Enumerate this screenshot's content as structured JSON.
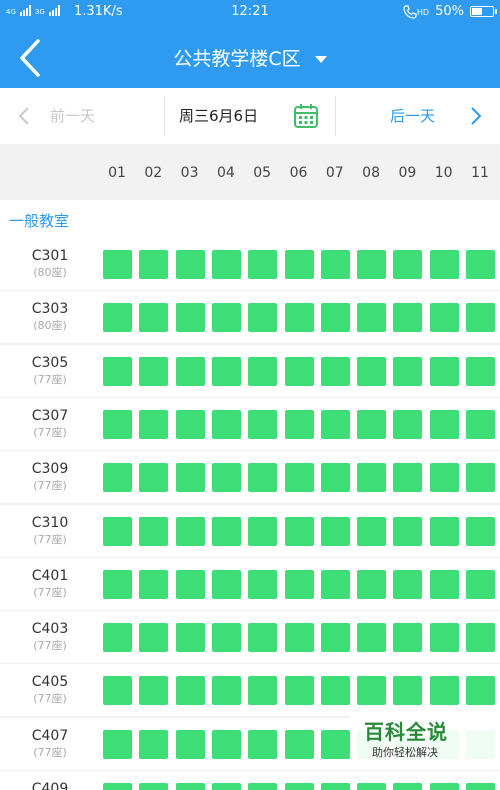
{
  "status_bar": {
    "network_left": "4G",
    "network_mid": "3G",
    "speed": "1.31K/s",
    "time": "12:21",
    "hd_label": "HD",
    "battery": "50%",
    "battery_level": 0.5
  },
  "header": {
    "title": "公共教学楼C区"
  },
  "date_bar": {
    "prev_label": "前一天",
    "current_date": "周三6月6日",
    "next_label": "后一天"
  },
  "columns": [
    "01",
    "02",
    "03",
    "04",
    "05",
    "06",
    "07",
    "08",
    "09",
    "10",
    "11"
  ],
  "section": {
    "label": "一般教室"
  },
  "rooms": [
    {
      "name": "C301",
      "capacity": "(80座)"
    },
    {
      "name": "C303",
      "capacity": "(80座)"
    },
    {
      "name": "C305",
      "capacity": "(77座)"
    },
    {
      "name": "C307",
      "capacity": "(77座)"
    },
    {
      "name": "C309",
      "capacity": "(77座)"
    },
    {
      "name": "C310",
      "capacity": "(77座)"
    },
    {
      "name": "C401",
      "capacity": "(77座)"
    },
    {
      "name": "C403",
      "capacity": "(77座)"
    },
    {
      "name": "C405",
      "capacity": "(77座)"
    },
    {
      "name": "C407",
      "capacity": "(77座)"
    },
    {
      "name": "C409",
      "capacity": ""
    }
  ],
  "colors": {
    "brand": "#2e9bf0",
    "available": "#3dde76"
  },
  "watermark": {
    "title": "百科全说",
    "subtitle": "助你轻松解决"
  }
}
